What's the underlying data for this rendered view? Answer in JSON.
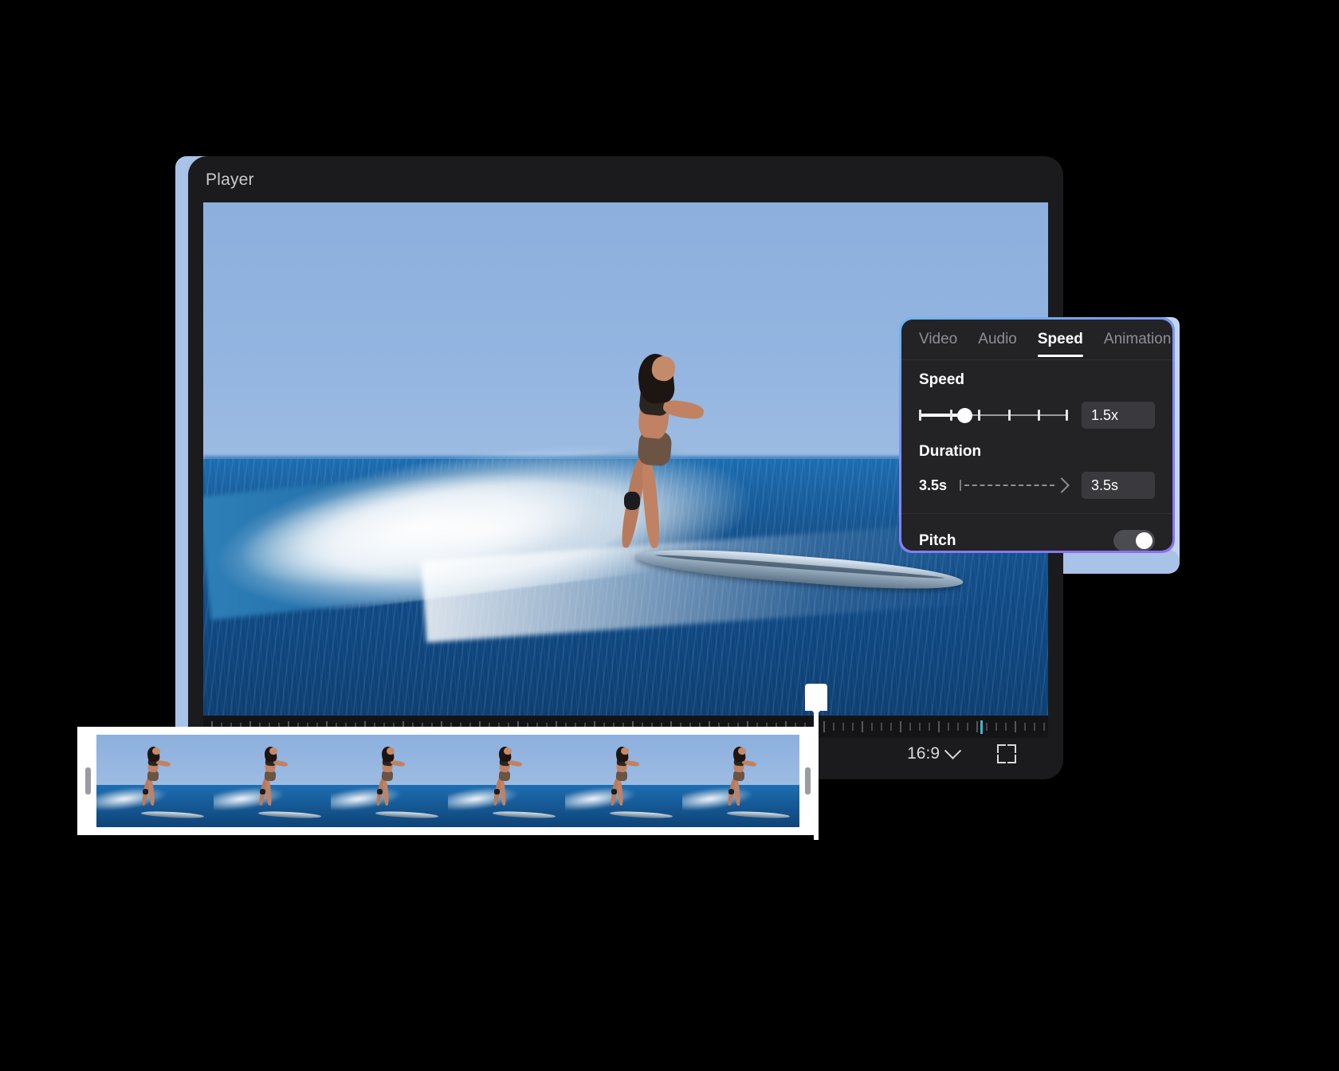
{
  "window": {
    "title": "Player"
  },
  "player_controls": {
    "aspect_ratio": "16:9",
    "ratio_icon": "chevron-down-icon",
    "fullscreen_icon": "fullscreen-icon"
  },
  "settings_panel": {
    "tabs": [
      {
        "label": "Video",
        "active": false
      },
      {
        "label": "Audio",
        "active": false
      },
      {
        "label": "Speed",
        "active": true
      },
      {
        "label": "Animation",
        "active": false
      }
    ],
    "speed": {
      "label": "Speed",
      "value": "1.5x",
      "slider_position_percent": 29,
      "tick_count": 5
    },
    "duration": {
      "label": "Duration",
      "from": "3.5s",
      "to": "3.5s",
      "arrow_icon": "arrow-right-dashed-icon"
    },
    "pitch": {
      "label": "Pitch",
      "enabled": true
    },
    "accent_gradient": [
      "#6fb8ea",
      "#7f8cf0",
      "#8b6ef0"
    ]
  },
  "timeline": {
    "playhead_color": "#3fb6cf",
    "frame_count": 6,
    "trim_handle_left": "trim-handle",
    "trim_handle_right": "trim-handle"
  },
  "colors": {
    "window_bg": "#1b1b1d",
    "panel_bg": "#232326",
    "plate_blue": "#a8c2e8",
    "text_primary": "#ffffff",
    "text_muted": "#8e8f96"
  }
}
